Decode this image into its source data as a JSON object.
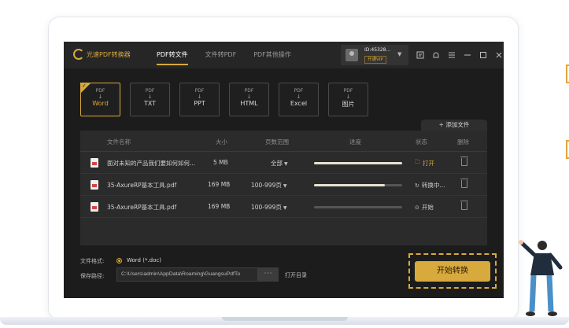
{
  "app": {
    "logo_text": "光速PDF转换器",
    "nav_tabs": [
      {
        "label": "PDF转文件",
        "active": true
      },
      {
        "label": "文件转PDF",
        "active": false
      },
      {
        "label": "PDF其他操作",
        "active": false
      }
    ],
    "user": {
      "id": "ID:45328...",
      "vip_button": "开通VIP"
    },
    "window_icons": [
      "feedback-icon",
      "notification-icon",
      "menu-icon",
      "minimize-icon",
      "maximize-icon",
      "close-icon"
    ]
  },
  "formats": [
    {
      "top": "PDF",
      "arrow": "↓",
      "name": "Word",
      "selected": true
    },
    {
      "top": "PDF",
      "arrow": "↓",
      "name": "TXT",
      "selected": false
    },
    {
      "top": "PDF",
      "arrow": "↓",
      "name": "PPT",
      "selected": false
    },
    {
      "top": "PDF",
      "arrow": "↓",
      "name": "HTML",
      "selected": false
    },
    {
      "top": "PDF",
      "arrow": "↓",
      "name": "Excel",
      "selected": false
    },
    {
      "top": "PDF",
      "arrow": "↓",
      "name": "图片",
      "selected": false
    }
  ],
  "file_panel": {
    "add_file": "+ 添加文件",
    "columns": {
      "name": "文件名称",
      "size": "大小",
      "pages": "页数范围",
      "progress": "进度",
      "status": "状态",
      "delete": "删除"
    },
    "rows": [
      {
        "name": "面对未知的产品我们要如何如何...",
        "size": "5 MB",
        "pages": "全部",
        "progress": 1.0,
        "status": "打开",
        "status_icon": "folder-icon",
        "status_type": "open"
      },
      {
        "name": "35-AxureRP基本工具.pdf",
        "size": "169 MB",
        "pages": "100-999页",
        "progress": 0.8,
        "status": "转换中...",
        "status_icon": "converting-icon",
        "status_type": "converting"
      },
      {
        "name": "35-AxureRP基本工具.pdf",
        "size": "169 MB",
        "pages": "100-999页",
        "progress": 0.0,
        "status": "开始",
        "status_icon": "play-icon",
        "status_type": "start"
      }
    ]
  },
  "bottom": {
    "format_label": "文件格式:",
    "format_value": "Word  (*.doc)",
    "path_label": "保存路径:",
    "path_value": "C:\\Users\\admin\\AppData\\Roaming\\GuangsuPdfTo",
    "browse_button": "···",
    "open_dir": "打开目录",
    "start_button": "开始转换"
  },
  "colors": {
    "accent": "#d8a93c",
    "background": "#1c1c1c",
    "panel": "#2b2b2b"
  }
}
